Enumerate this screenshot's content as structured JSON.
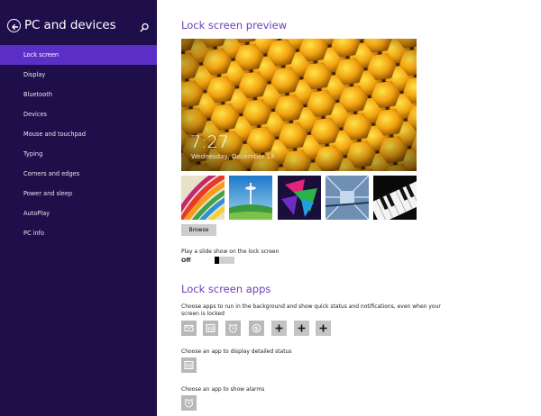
{
  "sidebar": {
    "title": "PC and devices",
    "items": [
      {
        "label": "Lock screen",
        "active": true
      },
      {
        "label": "Display",
        "active": false
      },
      {
        "label": "Bluetooth",
        "active": false
      },
      {
        "label": "Devices",
        "active": false
      },
      {
        "label": "Mouse and touchpad",
        "active": false
      },
      {
        "label": "Typing",
        "active": false
      },
      {
        "label": "Corners and edges",
        "active": false
      },
      {
        "label": "Power and sleep",
        "active": false
      },
      {
        "label": "AutoPlay",
        "active": false
      },
      {
        "label": "PC info",
        "active": false
      }
    ]
  },
  "preview": {
    "heading": "Lock screen preview",
    "time": "7:27",
    "date": "Wednesday, December 18"
  },
  "browse_label": "Browse",
  "slideshow": {
    "label": "Play a slide show on the lock screen",
    "state": "Off"
  },
  "apps": {
    "heading": "Lock screen apps",
    "description_line1": "Choose apps to run in the background and show quick status and notifications, even when your",
    "description_line2": "screen is locked",
    "quick_status_slots": [
      "mail-icon",
      "calendar-icon",
      "alarm-icon",
      "skype-icon",
      "add-icon",
      "add-icon",
      "add-icon"
    ],
    "detailed_label": "Choose an app to display detailed status",
    "detailed_slot": "calendar-icon",
    "alarms_label": "Choose an app to show alarms",
    "alarms_slot": "alarm-icon"
  },
  "colors": {
    "sidebar_bg": "#1e0e4a",
    "sidebar_active": "#5a2ec7",
    "heading": "#6b3fb8"
  }
}
